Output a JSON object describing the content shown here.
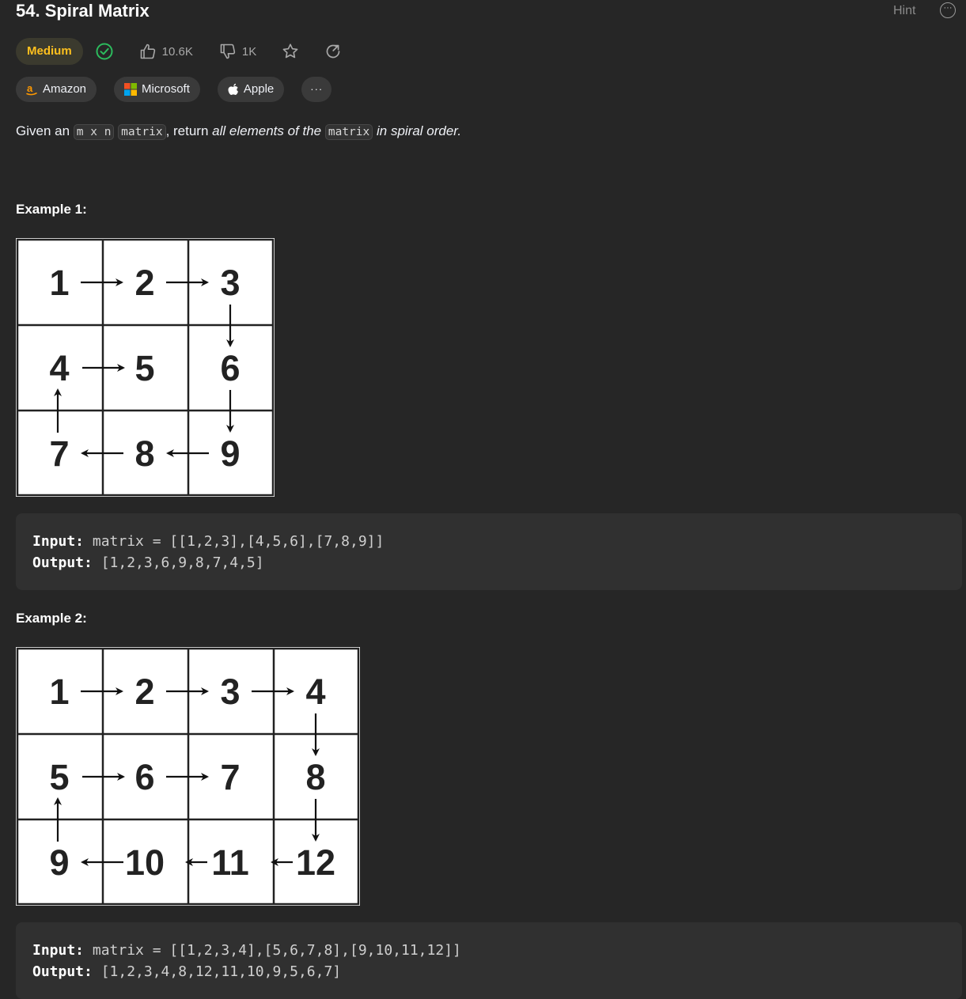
{
  "problem": {
    "title": "54. Spiral Matrix",
    "hint_label": "Hint",
    "difficulty": "Medium",
    "likes": "10.6K",
    "dislikes": "1K"
  },
  "companies": [
    {
      "name": "Amazon"
    },
    {
      "name": "Microsoft"
    },
    {
      "name": "Apple"
    }
  ],
  "more_companies": "···",
  "description": {
    "given_an": "Given an",
    "m_x_n": "m x n",
    "matrix_code": "matrix",
    "comma_return": ", return",
    "all_elements_of_the": "all elements of the",
    "in_spiral_order": "in spiral order."
  },
  "examples": [
    {
      "title": "Example 1:",
      "grid": [
        [
          "1",
          "2",
          "3"
        ],
        [
          "4",
          "5",
          "6"
        ],
        [
          "7",
          "8",
          "9"
        ]
      ],
      "input_label": "Input:",
      "input_value": "matrix = [[1,2,3],[4,5,6],[7,8,9]]",
      "output_label": "Output:",
      "output_value": "[1,2,3,6,9,8,7,4,5]"
    },
    {
      "title": "Example 2:",
      "grid": [
        [
          "1",
          "2",
          "3",
          "4"
        ],
        [
          "5",
          "6",
          "7",
          "8"
        ],
        [
          "9",
          "10",
          "11",
          "12"
        ]
      ],
      "input_label": "Input:",
      "input_value": "matrix = [[1,2,3,4],[5,6,7,8],[9,10,11,12]]",
      "output_label": "Output:",
      "output_value": "[1,2,3,4,8,12,11,10,9,5,6,7]"
    }
  ],
  "colors": {
    "difficulty": "#ffc01e",
    "solved": "#2cbb5d",
    "background": "#262626"
  }
}
